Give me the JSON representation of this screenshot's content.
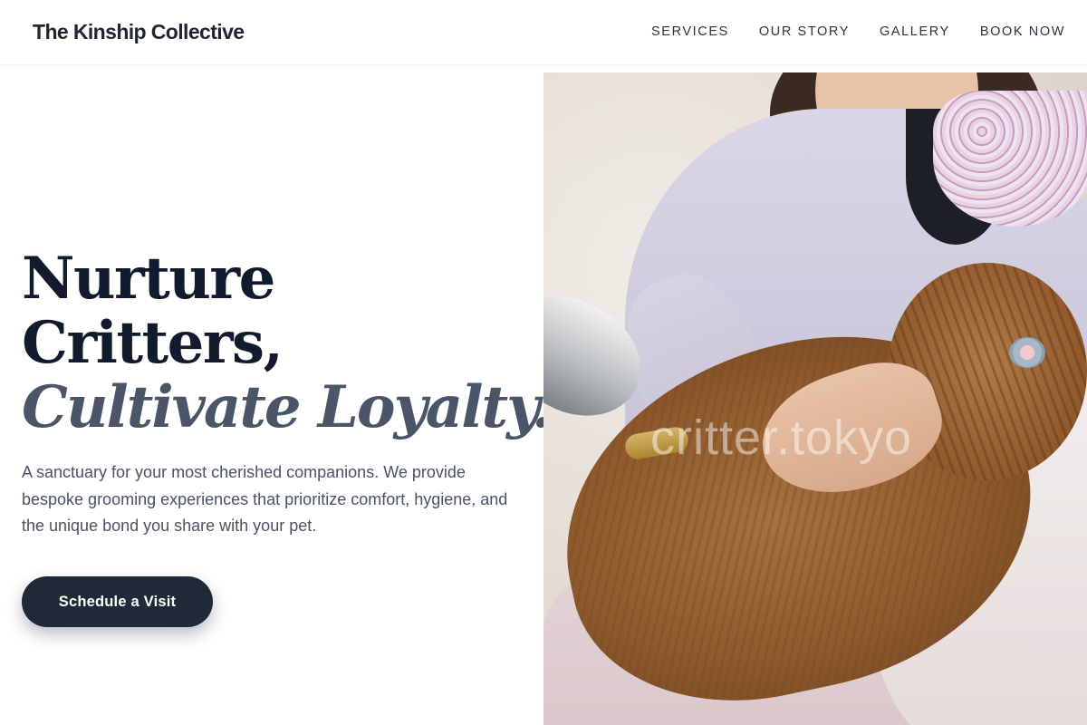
{
  "header": {
    "brand": "The Kinship Collective",
    "nav": [
      {
        "label": "SERVICES"
      },
      {
        "label": "OUR STORY"
      },
      {
        "label": "GALLERY"
      },
      {
        "label": "BOOK NOW"
      }
    ]
  },
  "hero": {
    "headline_line_1": "Nurture",
    "headline_line_2": "Critters,",
    "headline_accent": "Cultivate Loyalty.",
    "description": "A sanctuary for your most cherished companions. We provide bespoke grooming experiences that prioritize comfort, hygiene, and the unique bond you share with your pet.",
    "cta_label": "Schedule a Visit",
    "image": {
      "alt": "Groomer blow-drying a long-haired dog on a towel",
      "watermark": "critter.tokyo"
    }
  },
  "colors": {
    "headline": "#121a2e",
    "accent_text": "#4a5568",
    "button": "#1f2937",
    "body_text": "#4a5363"
  }
}
